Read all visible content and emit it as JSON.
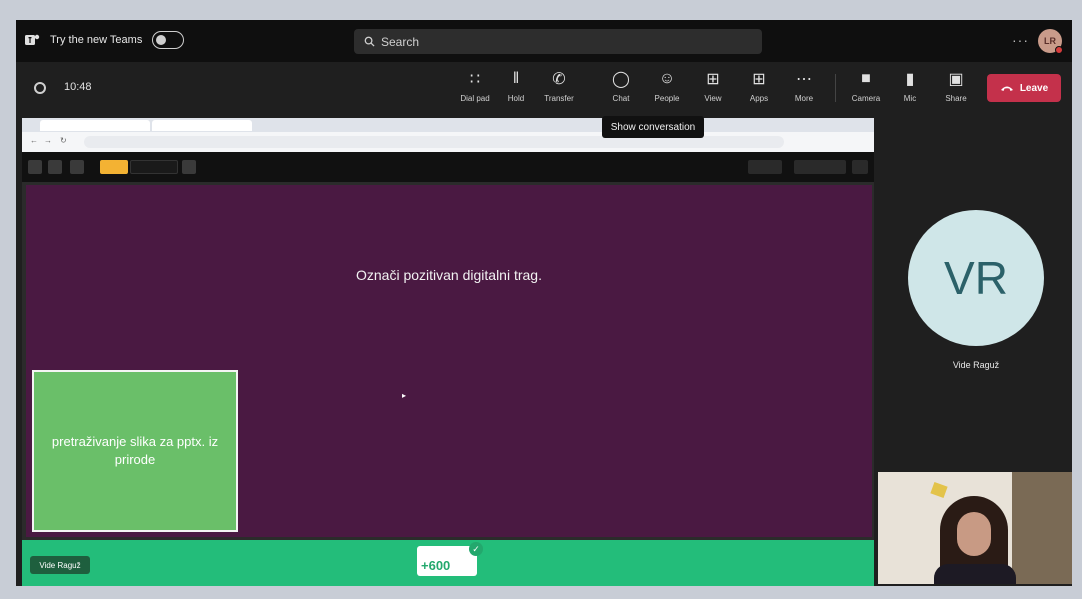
{
  "titlebar": {
    "try_label": "Try the new Teams",
    "search_placeholder": "Search",
    "more": "···",
    "avatar_initials": "LR"
  },
  "meeting": {
    "time": "10:48",
    "toolbar": [
      {
        "label": "Dial pad",
        "icon": "dialpad-icon"
      },
      {
        "label": "Hold",
        "icon": "hold-icon"
      },
      {
        "label": "Transfer",
        "icon": "transfer-icon"
      },
      {
        "label": "Chat",
        "icon": "chat-icon"
      },
      {
        "label": "People",
        "icon": "people-icon"
      },
      {
        "label": "View",
        "icon": "view-icon"
      },
      {
        "label": "Apps",
        "icon": "apps-icon"
      },
      {
        "label": "More",
        "icon": "more-icon"
      },
      {
        "label": "Camera",
        "icon": "camera-icon"
      },
      {
        "label": "Mic",
        "icon": "mic-icon"
      },
      {
        "label": "Share",
        "icon": "share-icon"
      }
    ],
    "leave_label": "Leave",
    "tooltip": "Show conversation"
  },
  "shared": {
    "question": "Označi pozitivan digitalni trag.",
    "answer": "pretraživanje slika za pptx. iz prirode",
    "player_name": "Vide Raguž",
    "score_points": "+600",
    "colors": {
      "slide": "#4a1942",
      "answer": "#6abf69",
      "scorebar": "#23bd7a",
      "leave": "#c4314b"
    }
  },
  "participant": {
    "initials": "VR",
    "name": "Vide Raguž"
  }
}
